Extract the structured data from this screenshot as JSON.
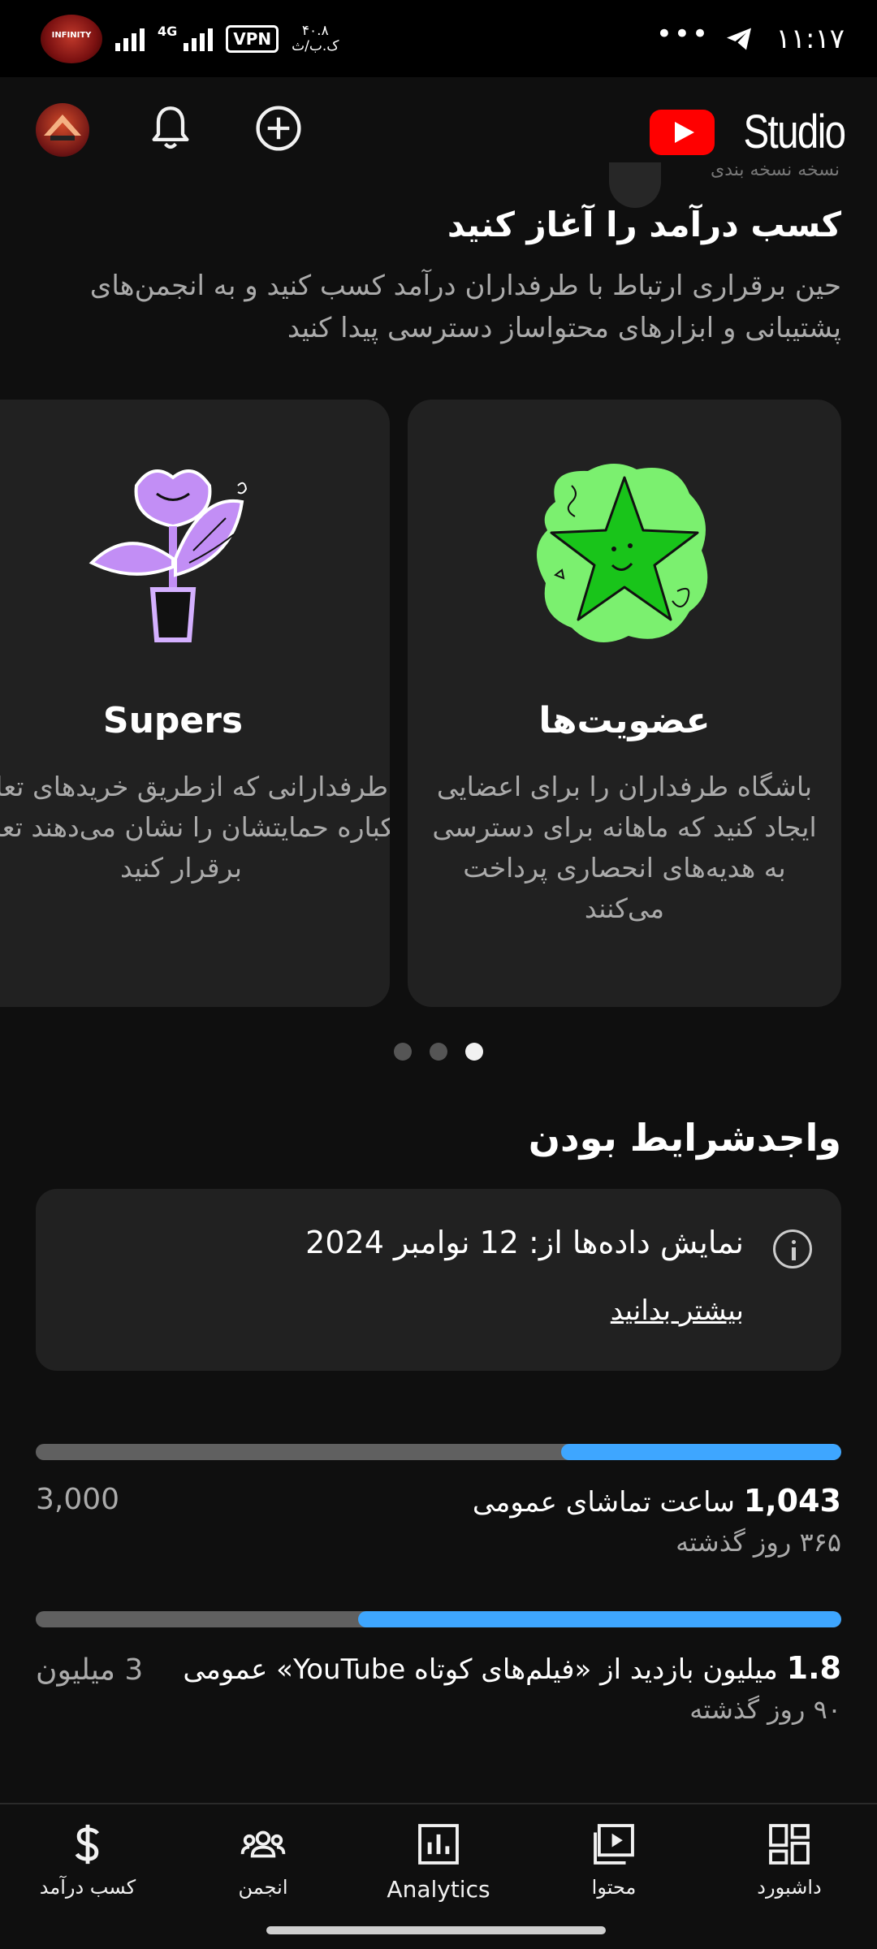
{
  "status_bar": {
    "time": "۱۱:۱۷",
    "dots": "•••",
    "network": "4G",
    "vpn": "VPN",
    "speed_value": "۴۰.۸",
    "speed_unit": "ک.ب/ث",
    "overlay_logo_text": "INFINITY"
  },
  "app_bar": {
    "studio_label": "Studio"
  },
  "intro": {
    "partial_text": "نسخه نسخه بندی",
    "title": "کسب درآمد را آغاز کنید",
    "description": "حین برقراری ارتباط با طرفداران درآمد کسب کنید و به انجمن‌های پشتیبانی و ابزارهای محتواساز دسترسی پیدا کنید"
  },
  "cards": [
    {
      "title": "عضویت‌ها",
      "description": "باشگاه طرفداران را برای اعضایی ایجاد کنید که ماهانه برای دسترسی به هدیه‌های انحصاری پرداخت می‌کنند"
    },
    {
      "title": "Supers",
      "description": "با طرفدارانی که ازطریق خریدهای تعاملی یکباره حمایتشان را نشان می‌دهند تعامل برقرار کنید"
    }
  ],
  "carousel": {
    "count": 3,
    "active": 2
  },
  "eligibility": {
    "title": "واجدشرایط بودن",
    "info_text": "نمایش داده‌ها از: 12 نوامبر 2024",
    "learn_more": "بیشتر بدانید"
  },
  "metrics": [
    {
      "value": "1,043",
      "label": "ساعت تماشای عمومی",
      "period": "۳۶۵ روز گذشته",
      "target": "3,000",
      "progress": 0.348
    },
    {
      "value": "1.8",
      "label": "میلیون بازدید از «فیلم‌های کوتاه YouTube» عمومی",
      "period": "۹۰ روز گذشته",
      "target": "3 میلیون",
      "progress": 0.6
    }
  ],
  "bottom_nav": [
    {
      "label": "کسب درآمد",
      "icon": "dollar-icon"
    },
    {
      "label": "انجمن",
      "icon": "community-icon"
    },
    {
      "label": "Analytics",
      "icon": "analytics-icon"
    },
    {
      "label": "محتوا",
      "icon": "content-icon"
    },
    {
      "label": "داشبورد",
      "icon": "dashboard-icon"
    }
  ],
  "colors": {
    "background": "#0f0f0f",
    "card": "#212121",
    "accent_blue": "#3ea6ff",
    "youtube_red": "#ff0000",
    "progress_track": "#606060"
  }
}
